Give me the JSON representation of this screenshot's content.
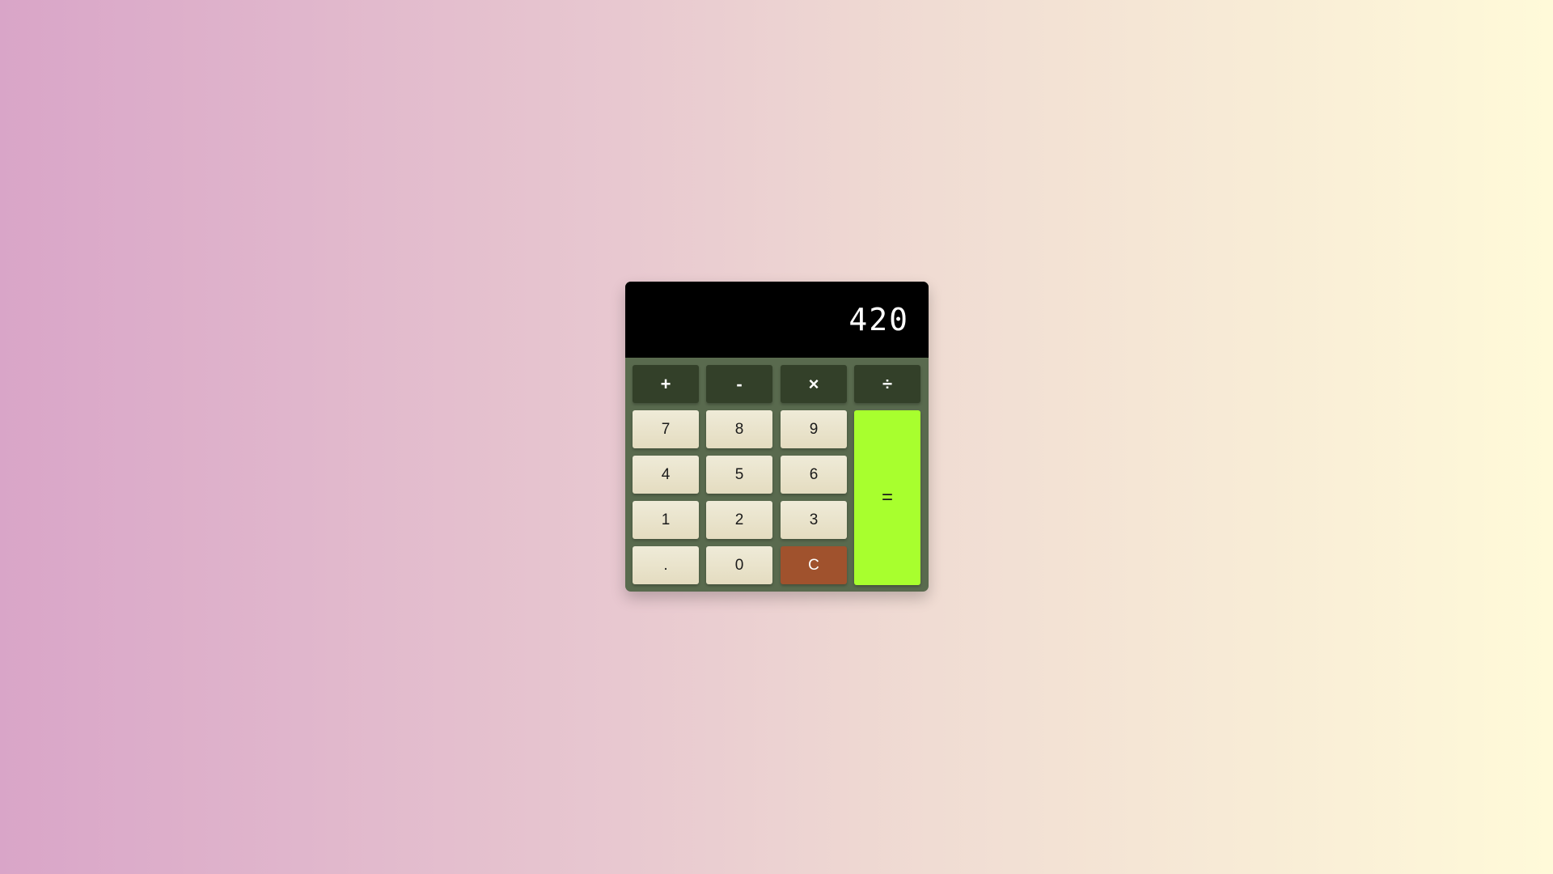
{
  "display": {
    "value": "420"
  },
  "operators": {
    "add": "+",
    "subtract": "-",
    "multiply": "×",
    "divide": "÷"
  },
  "keys": {
    "seven": "7",
    "eight": "8",
    "nine": "9",
    "four": "4",
    "five": "5",
    "six": "6",
    "one": "1",
    "two": "2",
    "three": "3",
    "decimal": ".",
    "zero": "0",
    "clear": "C",
    "equals": "="
  },
  "colors": {
    "body": "#596a4e",
    "display_bg": "#000000",
    "operator_bg": "#334029",
    "number_bg": "#e9e3cb",
    "clear_bg": "#a0522d",
    "equals_bg": "#a8ff2e"
  }
}
